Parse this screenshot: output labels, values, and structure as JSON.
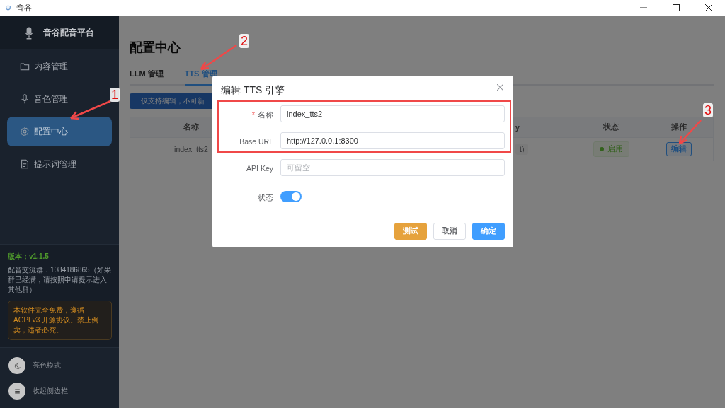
{
  "window": {
    "title": "音谷"
  },
  "sidebar": {
    "app_name": "音谷配音平台",
    "items": [
      {
        "label": "内容管理",
        "selected": false
      },
      {
        "label": "音色管理",
        "selected": false
      },
      {
        "label": "配置中心",
        "selected": true
      },
      {
        "label": "提示词管理",
        "selected": false
      }
    ],
    "version": "版本：v1.1.5",
    "group_note": "配音交流群：1084186865（如果群已经满，请按照申请提示进入其他群）",
    "license_note": "本软件完全免费，遵循 AGPLv3 开源协议。禁止倒卖，违者必究。",
    "footer_items": [
      {
        "label": "亮色模式"
      },
      {
        "label": "收起侧边栏"
      }
    ]
  },
  "page": {
    "title": "配置中心",
    "tabs": [
      {
        "label": "LLM 管理",
        "selected": false
      },
      {
        "label": "TTS 管理",
        "selected": true
      }
    ],
    "notice": "仅支持编辑，不可新",
    "table": {
      "columns": [
        "名称",
        "y",
        "状态",
        "操作"
      ],
      "rows": [
        {
          "name": "index_tts2",
          "column_2": "t)",
          "status": "启用",
          "enabled": true,
          "action": "编辑"
        }
      ]
    }
  },
  "dialog": {
    "title": "编辑 TTS 引擎",
    "fields": [
      {
        "label": "名称",
        "required_mark": "*",
        "value": "index_tts2"
      },
      {
        "label": "Base URL",
        "value": "http://127.0.0.1:8300"
      },
      {
        "label": "API Key",
        "placeholder": "可留空"
      }
    ],
    "status": {
      "label": "状态",
      "on": true
    },
    "buttons": [
      {
        "label": "测试",
        "kind": "warning"
      },
      {
        "label": "取消",
        "kind": "default"
      },
      {
        "label": "确定",
        "kind": "primary"
      }
    ]
  },
  "annotations": [
    {
      "label": "1"
    },
    {
      "label": "2"
    },
    {
      "label": "3"
    }
  ]
}
